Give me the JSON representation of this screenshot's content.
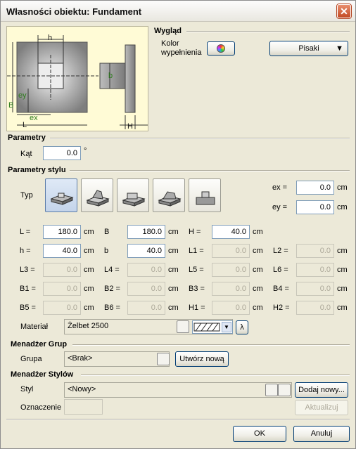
{
  "window": {
    "title": "Własności obiektu: Fundament",
    "close_label": "✕"
  },
  "preview": {
    "labels": {
      "h": "h",
      "b": "b",
      "B": "B",
      "L": "L",
      "ex": "ex",
      "ey": "ey",
      "H": "H"
    }
  },
  "appearance": {
    "heading": "Wygląd",
    "fill_color_label_1": "Kolor",
    "fill_color_label_2": "wypełnienia",
    "pens_button": "Pisaki"
  },
  "params": {
    "heading": "Parametry",
    "angle_label": "Kąt",
    "angle_value": "0.0",
    "angle_unit": "°"
  },
  "style_params": {
    "heading": "Parametry stylu",
    "type_label": "Typ",
    "ex_label": "ex  =",
    "ex_value": "0.0",
    "ex_unit": "cm",
    "ey_label": "ey  =",
    "ey_value": "0.0",
    "ey_unit": "cm",
    "row1": [
      {
        "label": "L =",
        "value": "180.0",
        "unit": "cm"
      },
      {
        "label": "B",
        "value": "180.0",
        "unit": "cm"
      },
      {
        "label": "H =",
        "value": "40.0",
        "unit": "cm"
      }
    ],
    "row2": [
      {
        "label": "h =",
        "value": "40.0",
        "unit": "cm"
      },
      {
        "label": "b",
        "value": "40.0",
        "unit": "cm"
      },
      {
        "label": "L1 =",
        "value": "0.0",
        "unit": "cm"
      },
      {
        "label": "L2 =",
        "value": "0.0",
        "unit": "cm"
      }
    ],
    "row3": [
      {
        "label": "L3 =",
        "value": "0.0",
        "unit": "cm"
      },
      {
        "label": "L4 =",
        "value": "0.0",
        "unit": "cm"
      },
      {
        "label": "L5 =",
        "value": "0.0",
        "unit": "cm"
      },
      {
        "label": "L6 =",
        "value": "0.0",
        "unit": "cm"
      }
    ],
    "row4": [
      {
        "label": "B1 =",
        "value": "0.0",
        "unit": "cm"
      },
      {
        "label": "B2 =",
        "value": "0.0",
        "unit": "cm"
      },
      {
        "label": "B3 =",
        "value": "0.0",
        "unit": "cm"
      },
      {
        "label": "B4 =",
        "value": "0.0",
        "unit": "cm"
      }
    ],
    "row5": [
      {
        "label": "B5 =",
        "value": "0.0",
        "unit": "cm"
      },
      {
        "label": "B6 =",
        "value": "0.0",
        "unit": "cm"
      },
      {
        "label": "H1 =",
        "value": "0.0",
        "unit": "cm"
      },
      {
        "label": "H2 =",
        "value": "0.0",
        "unit": "cm"
      }
    ],
    "material_label": "Materiał",
    "material_value": "Żelbet 2500",
    "lambda_label": "λ"
  },
  "groups": {
    "heading": "Menadżer Grup",
    "group_label": "Grupa",
    "group_value": "<Brak>",
    "create_button": "Utwórz nową"
  },
  "styles": {
    "heading": "Menadżer Stylów",
    "style_label": "Styl",
    "style_value": "<Nowy>",
    "add_button": "Dodaj nowy...",
    "mark_label": "Oznaczenie",
    "update_button": "Aktualizuj"
  },
  "footer": {
    "ok_button": "OK",
    "cancel_button": "Anuluj"
  }
}
